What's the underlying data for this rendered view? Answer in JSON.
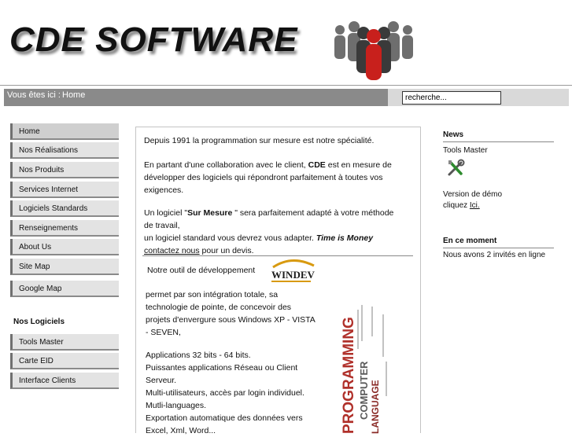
{
  "header": {
    "logo_text": "CDE SOFTWARE"
  },
  "navbar": {
    "breadcrumb_label": "Vous êtes ici :",
    "breadcrumb_home": "Home",
    "search_value": "recherche..."
  },
  "menu": {
    "items": [
      {
        "label": "Home",
        "active": true
      },
      {
        "label": "Nos Réalisations"
      },
      {
        "label": "Nos Produits"
      },
      {
        "label": "Services Internet"
      },
      {
        "label": "Logiciels Standards"
      },
      {
        "label": "Renseignements"
      },
      {
        "label": "About Us"
      },
      {
        "label": "Site Map"
      },
      {
        "label": "Google Map"
      }
    ],
    "section_title": "Nos Logiciels",
    "logiciels": [
      {
        "label": "Tools Master"
      },
      {
        "label": "Carte EID"
      },
      {
        "label": "Interface Clients"
      }
    ]
  },
  "content": {
    "p1": "Depuis 1991 la programmation sur mesure est notre spécialité.",
    "p2a": "En partant d'une collaboration avec le client, ",
    "p2b": "CDE",
    "p2c": " est en mesure de",
    "p2d": "développer des logiciels  qui répondront  parfaitement à toutes vos",
    "p2e": "exigences.",
    "p3a": "Un logiciel \"",
    "p3b": "Sur Mesure",
    "p3c": " \"  sera parfaitement adapté à votre méthode",
    "p3d": "de travail,",
    "p3e": "un logiciel standard vous devrez vous adapter. ",
    "p3f": "Time is Money",
    "contact_link": "contactez nous",
    "contact_rest": " pour un devis.",
    "windev_intro": "Notre outil de développement",
    "windev_logo": "WINDEV",
    "feat1": "permet par son intégration totale, sa",
    "feat2": "technologie de pointe, de concevoir des",
    "feat3": "projets d'envergure sous Windows XP - VISTA",
    "feat4": "- SEVEN,",
    "feat5": "Applications 32 bits - 64 bits.",
    "feat6": "Puissantes applications Réseau ou Client",
    "feat7": "Serveur.",
    "feat8": "Multi-utilisateurs, accès par login individuel.",
    "feat9": "Mutli-languages.",
    "feat10": "Exportation automatique des données vers",
    "feat11": "Excel, Xml, Word...",
    "cloud_words": [
      "PROGRAMMING",
      "COMPUTER",
      "LANGUAGE"
    ]
  },
  "sidebar": {
    "news_title": "News",
    "news_item": "Tools Master",
    "demo_line1": "Version de démo",
    "demo_line2": "cliquez ",
    "demo_link": "Ici.",
    "now_title": "En ce moment",
    "now_text": "Nous avons 2 invités en ligne"
  },
  "colors": {
    "navbar": "#8a8a8a",
    "menu_bg": "#e3e3e3",
    "menu_border": "#707070",
    "cloud_red": "#b0302a"
  }
}
